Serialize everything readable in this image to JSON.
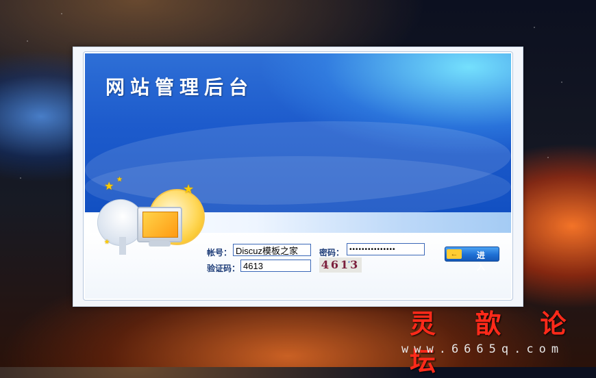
{
  "banner": {
    "title": "网站管理后台"
  },
  "form": {
    "account_label": "帐号：",
    "account_value": "Discuz模板之家",
    "password_label": "密码：",
    "password_value": "•••••••••••••••",
    "captcha_label": "验证码：",
    "captcha_value": "4613",
    "captcha_image_text": "4613",
    "enter_button": "进 入",
    "enter_icon": "←"
  },
  "watermark": {
    "text": "灵 歆 论 坛",
    "url": "www.6665q.com"
  },
  "colors": {
    "accent": "#1d5bcc",
    "label": "#1e3d78",
    "watermark": "#ff2a1a"
  },
  "icons": [
    "satellite-dish-icon",
    "monitor-icon",
    "moon-icon",
    "star-icon",
    "key-arrow-icon"
  ]
}
